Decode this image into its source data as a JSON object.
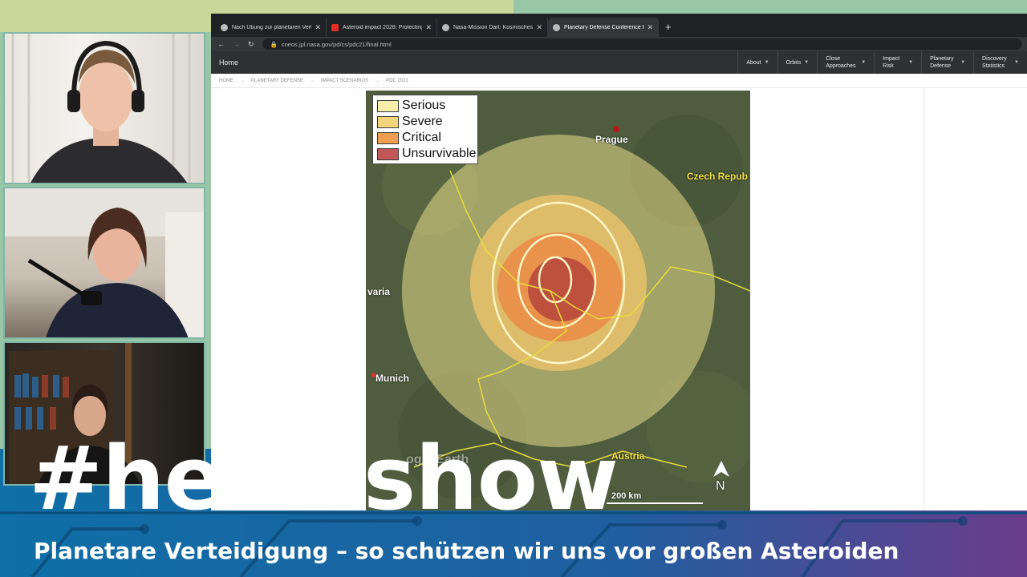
{
  "browser": {
    "tabs": [
      {
        "title": "Nach Übung zur planetaren Vert",
        "icon": "globe-icon",
        "active": false
      },
      {
        "title": "Asteroid impact 2028: Protecting",
        "icon": "youtube-icon",
        "active": false
      },
      {
        "title": "Nasa-Mission Dart: Kosmisches B",
        "icon": "globe-icon",
        "active": false
      },
      {
        "title": "Planetary Defense Conference Ex",
        "icon": "globe-icon",
        "active": true
      }
    ],
    "address": "cneos.jpl.nasa.gov/pd/cs/pdc21/final.html"
  },
  "site": {
    "home": "Home",
    "nav": [
      {
        "label": "About"
      },
      {
        "label": "Orbits"
      },
      {
        "label": "Close Approaches"
      },
      {
        "label": "Impact Risk"
      },
      {
        "label": "Planetary Defense"
      },
      {
        "label": "Discovery Statistics"
      }
    ],
    "breadcrumbs": [
      "HOME",
      "PLANETARY DEFENSE",
      "IMPACT SCENARIOS",
      "PDC 2021"
    ]
  },
  "map": {
    "legend": [
      {
        "label": "Serious",
        "color": "#f6eeaa"
      },
      {
        "label": "Severe",
        "color": "#f2d47a"
      },
      {
        "label": "Critical",
        "color": "#ee9f52"
      },
      {
        "label": "Unsurvivable",
        "color": "#c2575a"
      }
    ],
    "labels": {
      "prague": "Prague",
      "czech": "Czech Repub",
      "bavaria": "varia",
      "munich": "Munich",
      "austria": "Austria",
      "north": "N",
      "scale": "200 km",
      "watermark": "ogle Earth"
    }
  },
  "overlay": {
    "headline": "#heiseshow",
    "subtitle": "Planetare Verteidigung – so schützen wir uns vor großen Asteroiden"
  }
}
